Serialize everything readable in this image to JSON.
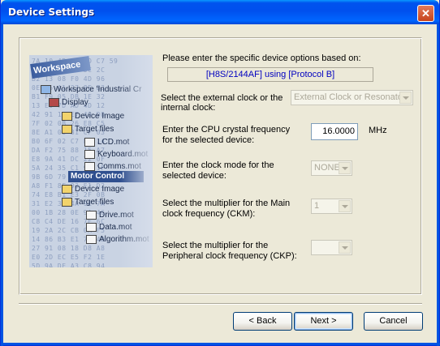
{
  "window": {
    "title": "Device Settings",
    "close_glyph": "✕"
  },
  "illustration": {
    "workspace_label": "Workspace",
    "tree": [
      "Workspace 'Industrial Cr",
      "Display",
      "Device Image",
      "Target files",
      "LCD.mot",
      "Keyboard.mot",
      "Comms.mot",
      "Motor Control",
      "Device Image",
      "Target files",
      "Drive.mot",
      "Data.mot",
      "Algorithm.mot"
    ]
  },
  "form": {
    "intro": "Please enter the specific device options based on:",
    "device_info": "[H8S/2144AF]  using  [Protocol B]",
    "clock_source_label_1": "Select the external clock or the",
    "clock_source_label_2": "internal clock:",
    "clock_source_value": "External Clock or Resonato",
    "crystal_label_1": "Enter the CPU crystal frequency",
    "crystal_label_2": "for the selected device:",
    "crystal_value": "16.0000",
    "crystal_unit": "MHz",
    "clock_mode_label_1": "Enter the clock mode for the",
    "clock_mode_label_2": "selected device:",
    "clock_mode_value": "NONE",
    "ckm_label_1": "Select the multiplier for the Main",
    "ckm_label_2": "clock frequency (CKM):",
    "ckm_value": "1",
    "ckp_label_1": "Select the multiplier for the",
    "ckp_label_2": "Peripheral clock frequency (CKP):",
    "ckp_value": ""
  },
  "buttons": {
    "back": "< Back",
    "next": "Next >",
    "cancel": "Cancel"
  },
  "colors": {
    "titlebar": "#0054e3",
    "dialog_bg": "#ece9d8",
    "info_text": "#0000c0"
  }
}
